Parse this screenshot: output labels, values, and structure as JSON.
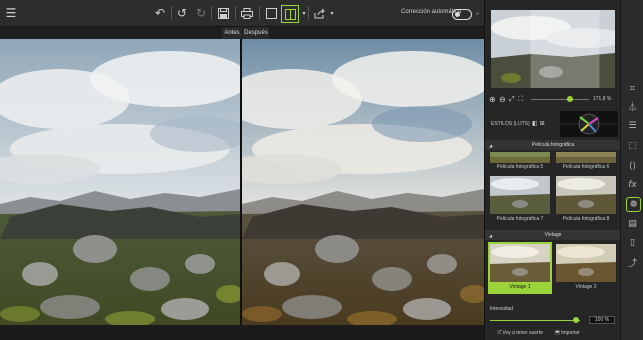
{
  "toolbar": {
    "icons": [
      "menu-icon",
      "undo-icon",
      "redo-icon",
      "redo-alt-icon",
      "save-icon",
      "print-icon",
      "single-view-icon",
      "split-view-icon",
      "chevron-down-icon",
      "export-icon"
    ],
    "auto_correct_label": "Corrección automática",
    "auto_correct_on": false
  },
  "compare": {
    "before_label": "Antes",
    "after_label": "Después"
  },
  "navigator": {
    "zoom_value": "171,8 %",
    "zoom_fraction": 0.68
  },
  "styles": {
    "label": "ESTILOS (LUTS)"
  },
  "sections": [
    {
      "title": "Película fotográfica",
      "items": [
        "Película fotográfica 5",
        "Película fotográfica 6",
        "Película fotográfica 7",
        "Película fotográfica 8"
      ]
    },
    {
      "title": "Vintage",
      "items": [
        "Vintage 1",
        "Vintage 2"
      ],
      "selected": "Vintage 1"
    }
  ],
  "intensity": {
    "label": "Intensidad",
    "value": "100 %",
    "fraction": 1.0
  },
  "actions": {
    "strong_label": "Voy a tener suerte",
    "import_label": "Importar"
  },
  "colors": {
    "accent": "#9bd33a",
    "toolbar_bg": "#2d2d2d",
    "panel_bg": "#262626"
  }
}
